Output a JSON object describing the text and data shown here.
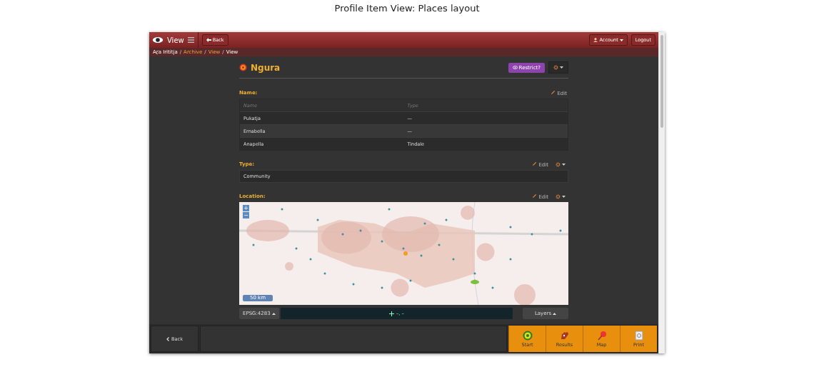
{
  "caption": "Profile Item View: Places layout",
  "header": {
    "title": "View",
    "back": "Back",
    "account": "Account",
    "logout": "Logout"
  },
  "breadcrumb_separator": "/",
  "breadcrumbs": [
    {
      "label": "Aṟa Irititja",
      "link": false
    },
    {
      "label": "Archive",
      "link": true
    },
    {
      "label": "View",
      "link": true
    },
    {
      "label": "View",
      "link": false
    }
  ],
  "item": {
    "title": "Ngura",
    "restrict": "Restrict?"
  },
  "name_section": {
    "label": "Name:",
    "edit": "Edit",
    "columns": [
      "Name",
      "Type"
    ],
    "rows": [
      [
        "Pukatja",
        "—"
      ],
      [
        "Ernabella",
        "—"
      ],
      [
        "Anapella",
        "Tindale"
      ]
    ]
  },
  "type_section": {
    "label": "Type:",
    "edit": "Edit",
    "value": "Community"
  },
  "location_section": {
    "label": "Location:",
    "edit": "Edit",
    "map": {
      "zoom_in": "+",
      "zoom_out": "−",
      "scale": "50 km"
    },
    "projection": "EPSG:4283",
    "coords": "–, –",
    "layers": "Layers"
  },
  "footer": {
    "back": "Back",
    "actions": [
      {
        "kind": "start",
        "label": "Start"
      },
      {
        "kind": "results",
        "label": "Results"
      },
      {
        "kind": "map",
        "label": "Map"
      },
      {
        "kind": "print",
        "label": "Print"
      }
    ]
  }
}
